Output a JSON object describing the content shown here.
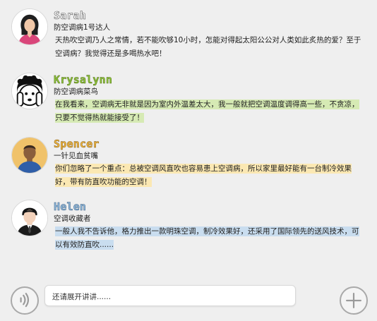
{
  "messages": [
    {
      "name": "Sarah",
      "title": "防空调病1号达人",
      "text": "天热吹空调乃人之常情，若不能吹够10小时，怎能对得起太阳公公对人类如此炙热的爱？至于空调病？我觉得还是多喝热水吧！",
      "name_color": "#ffffff",
      "bubble_color": "transparent"
    },
    {
      "name": "Krysalynn",
      "title": "防空调病菜鸟",
      "text": "在我看来，空调病无非就是因为室内外温差太大，我一般就把空调温度调得高一些，不贪凉，只要不觉得热就能接受了！",
      "name_color": "#8fc23c",
      "bubble_color": "#d6eab4"
    },
    {
      "name": "Spencer",
      "title": "一针见血贫嘴",
      "text": "你们忽略了一个重点：总被空调风直吹也容易患上空调病，所以家里最好能有一台制冷效果好，带有防直吹功能的空调！",
      "name_color": "#f3b941",
      "bubble_color": "#fbe8b3"
    },
    {
      "name": "Helen",
      "title": "空调收藏者",
      "text": "一般人我不告诉他，格力推出一款明珠空调，制冷效果好，还采用了国际领先的送风技术，可以有效防直吹......",
      "name_color": "#8fb7da",
      "bubble_color": "#c9ddef"
    }
  ],
  "composer": {
    "input_text": "还请展开讲讲......",
    "voice_icon": "voice-icon",
    "add_icon": "plus-icon"
  }
}
